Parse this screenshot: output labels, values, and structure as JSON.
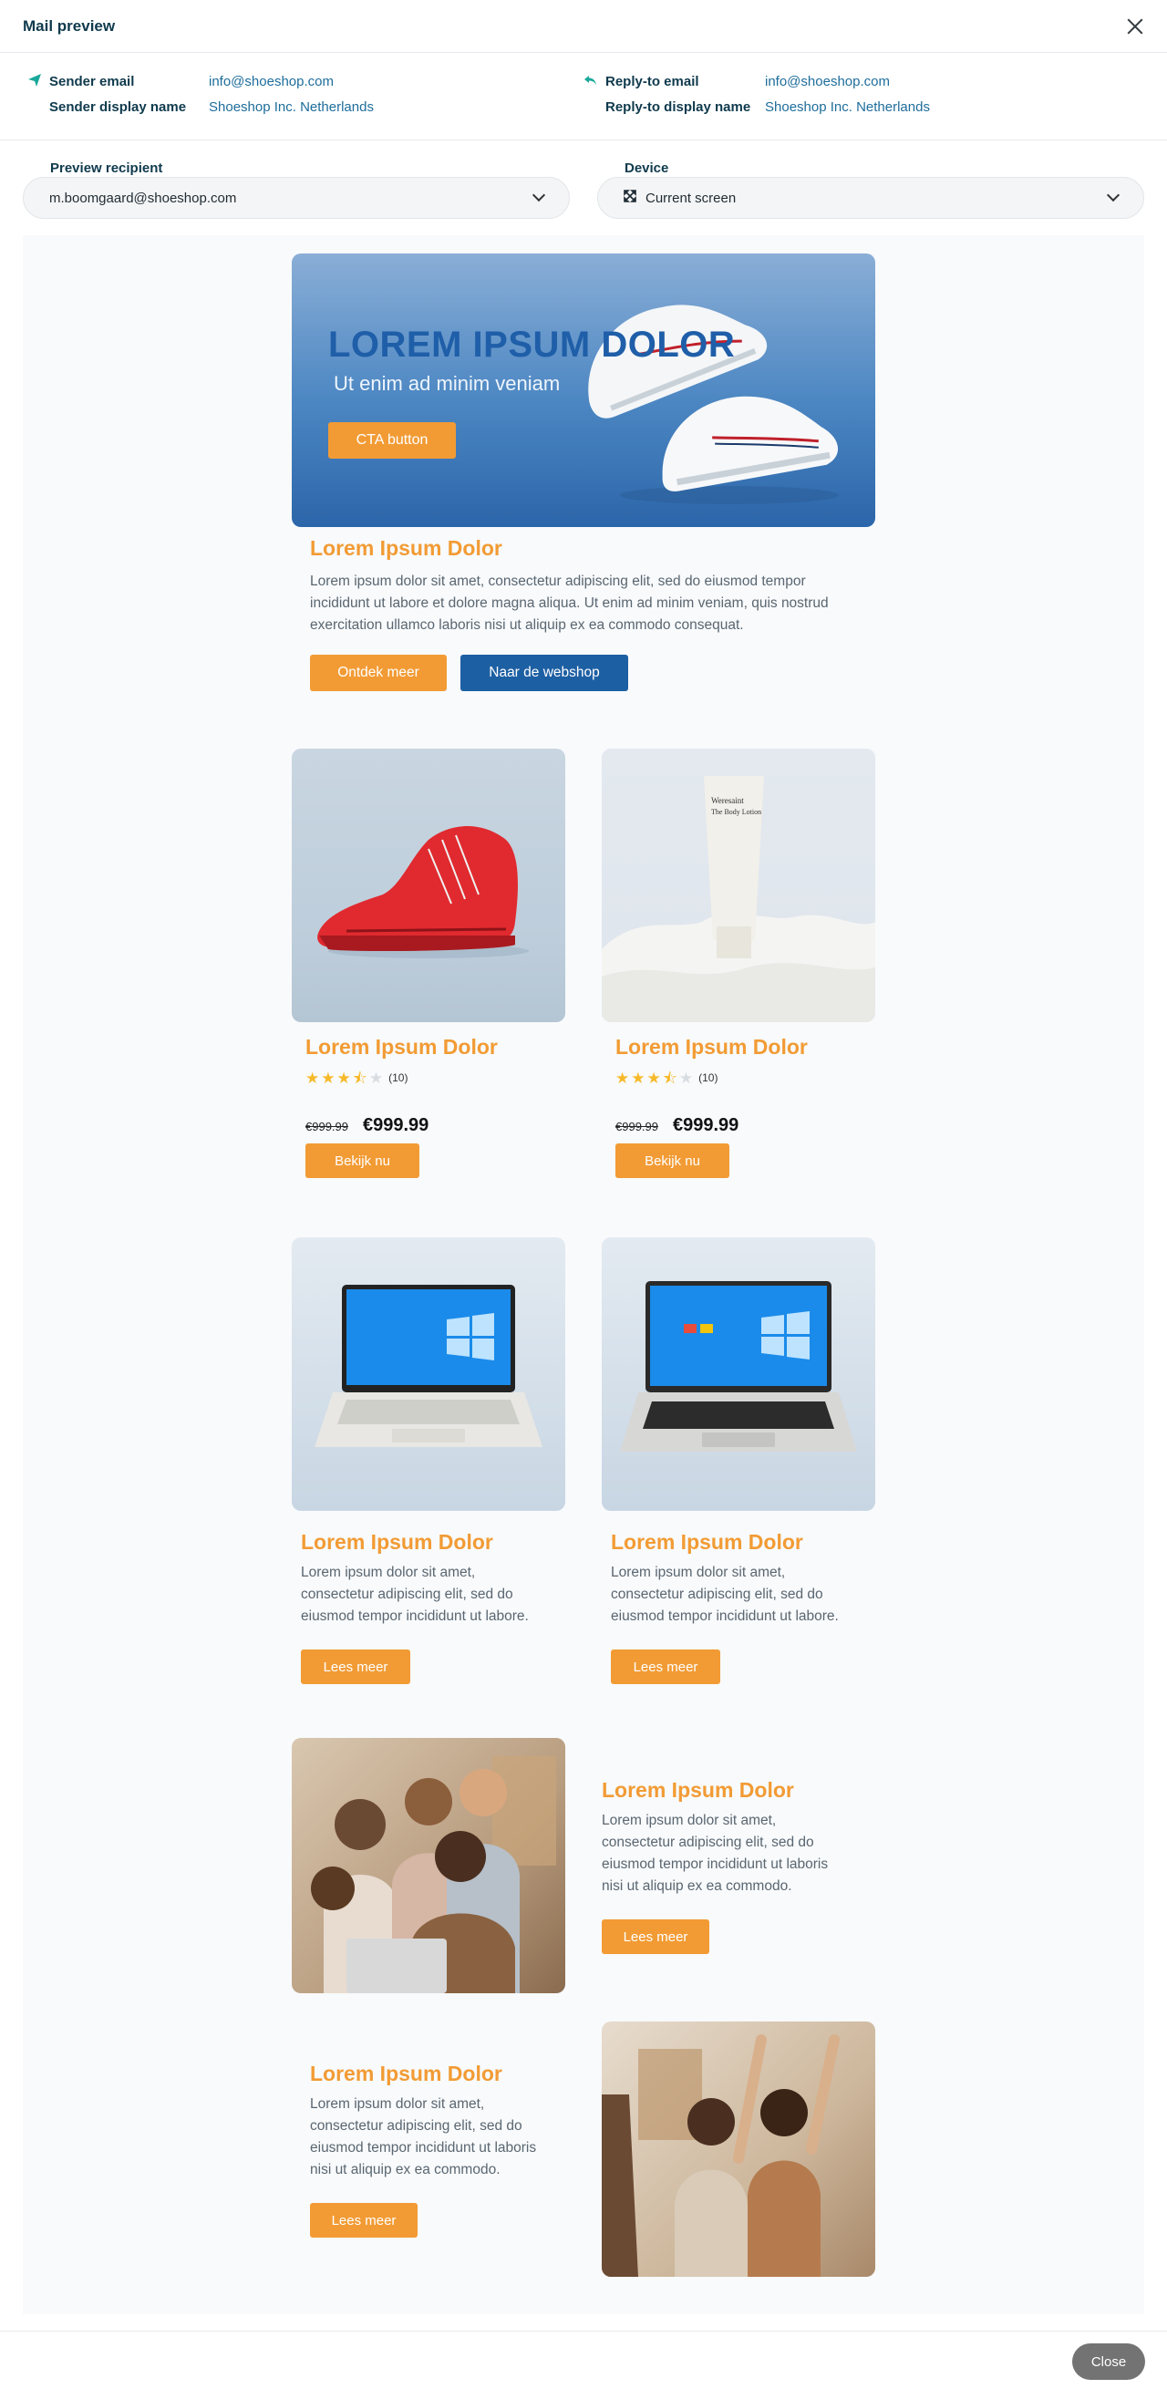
{
  "header": {
    "title": "Mail preview"
  },
  "sender": {
    "sender_email_label": "Sender email",
    "sender_email": "info@shoeshop.com",
    "sender_name_label": "Sender display name",
    "sender_name": "Shoeshop Inc. Netherlands",
    "reply_email_label": "Reply-to email",
    "reply_email": "info@shoeshop.com",
    "reply_name_label": "Reply-to display name",
    "reply_name": "Shoeshop Inc. Netherlands"
  },
  "recipient": {
    "label": "Preview recipient",
    "value": "m.boomgaard@shoeshop.com"
  },
  "device": {
    "label": "Device",
    "value": "Current screen"
  },
  "email": {
    "hero": {
      "title": "LOREM IPSUM DOLOR",
      "subtitle": "Ut enim ad minim veniam",
      "cta": "CTA button"
    },
    "intro": {
      "title": "Lorem Ipsum Dolor",
      "text": "Lorem ipsum dolor sit amet, consectetur adipiscing elit, sed do eiusmod tempor incididunt ut labore et dolore magna aliqua. Ut enim ad minim veniam, quis nostrud exercitation ullamco laboris nisi ut aliquip ex ea commodo consequat.",
      "btn_primary": "Ontdek meer",
      "btn_secondary": "Naar de webshop"
    },
    "products": [
      {
        "title": "Lorem Ipsum Dolor",
        "rating": 3.5,
        "count": "(10)",
        "old_price": "€999.99",
        "price": "€999.99",
        "button": "Bekijk nu"
      },
      {
        "title": "Lorem Ipsum Dolor",
        "rating": 3.5,
        "count": "(10)",
        "old_price": "€999.99",
        "price": "€999.99",
        "button": "Bekijk nu"
      }
    ],
    "laptops": [
      {
        "title": "Lorem Ipsum Dolor",
        "text": "Lorem ipsum dolor sit amet, consectetur adipiscing elit, sed do eiusmod tempor incididunt ut labore.",
        "button": "Lees meer"
      },
      {
        "title": "Lorem Ipsum Dolor",
        "text": "Lorem ipsum dolor sit amet, consectetur adipiscing elit, sed do eiusmod tempor incididunt ut labore.",
        "button": "Lees meer"
      }
    ],
    "feature1": {
      "title": "Lorem Ipsum Dolor",
      "text": "Lorem ipsum dolor sit amet, consectetur adipiscing elit, sed do eiusmod tempor incididunt ut laboris nisi ut aliquip ex ea commodo.",
      "button": "Lees meer"
    },
    "feature2": {
      "title": "Lorem Ipsum Dolor",
      "text": "Lorem ipsum dolor sit amet, consectetur adipiscing elit, sed do eiusmod tempor incididunt ut laboris nisi ut aliquip ex ea commodo.",
      "button": "Lees meer"
    }
  },
  "footer": {
    "close": "Close"
  },
  "colors": {
    "accent": "#f29b34",
    "brand_blue": "#1d5fa3",
    "teal": "#19a89a"
  }
}
